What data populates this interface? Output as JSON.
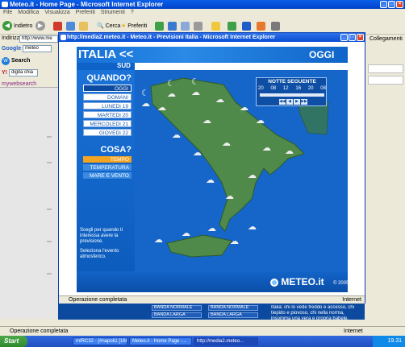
{
  "window": {
    "title": "Meteo.it - Home Page - Microsoft Internet Explorer"
  },
  "menubar": [
    "File",
    "Modifica",
    "Visualizza",
    "Preferiti",
    "Strumenti",
    "?"
  ],
  "toolbar": {
    "back_label": "Indietro",
    "search_label": "Cerca",
    "favorites_label": "Preferiti"
  },
  "address": {
    "label": "Indirizzo",
    "value": "http://www.me"
  },
  "links_label": "Collegamenti",
  "google": {
    "label": "Google",
    "value": "meteo"
  },
  "websearch": {
    "label": "Search"
  },
  "yahoo": {
    "value": "digita chia"
  },
  "mywebsearch": {
    "label": "mywebsearch"
  },
  "popup": {
    "title": "http://media2.meteo.it - Meteo.it - Previsioni Italia - Microsoft Internet Explorer",
    "status": "Operazione completata",
    "zone": "Internet"
  },
  "widget": {
    "region": "ITALIA <<",
    "today_header": "OGGI",
    "subregion": "SUD",
    "when_title": "QUANDO?",
    "days": [
      "OGGI",
      "DOMANI",
      "LUNEDì 19",
      "MARTEDì 20",
      "MERCOLEDì 21",
      "GIOVEDì 22"
    ],
    "what_title": "COSA?",
    "what_items": [
      "TEMPO",
      "TEMPERATURA",
      "MARE E VENTO"
    ],
    "help1": "Scegli per quando ti interessa avere la previsione.",
    "help2": "Seleziona l'evento atmosferico.",
    "slider_title": "NOTTE SEGUENTE",
    "hours": [
      "20",
      "08",
      "12",
      "16",
      "20",
      "08"
    ],
    "logo": "METEO.it",
    "copyright": "© 2005"
  },
  "page_bottom": {
    "bands": [
      "BANDA NORMALE",
      "BANDA LARGA",
      "BANDA NORMALE",
      "BANDA LARGA"
    ],
    "text": "Italia: chi lo vede freddo e accesso, chi tiepido e piovoso, chi nella norma, insomma una vera e propria babele."
  },
  "status": {
    "text": "Operazione completata",
    "zone": "Internet"
  },
  "taskbar": {
    "start": "Start",
    "tasks": [
      "mIRC32 - [#napoli1 [166...",
      "Meteo.it - Home Page -...",
      "http://media2.meteo..."
    ],
    "clock": "19.31"
  },
  "colors": {
    "accent_blue": "#1566c8",
    "selected_orange": "#f2a322",
    "titlebar": "#0a5ee8"
  }
}
